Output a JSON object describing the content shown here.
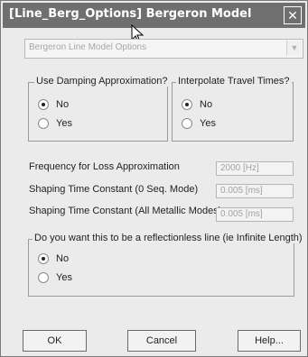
{
  "window": {
    "title": "[Line_Berg_Options] Bergeron Model"
  },
  "model_select": {
    "value": "Bergeron Line Model Options"
  },
  "damping": {
    "legend": "Use Damping Approximation?",
    "options": [
      {
        "label": "No",
        "checked": true
      },
      {
        "label": "Yes",
        "checked": false
      }
    ]
  },
  "travel": {
    "legend": "Interpolate Travel Times?",
    "options": [
      {
        "label": "No",
        "checked": true
      },
      {
        "label": "Yes",
        "checked": false
      }
    ]
  },
  "params": [
    {
      "label": "Frequency for Loss Approximation",
      "value": "2000 [Hz]"
    },
    {
      "label": "Shaping Time Constant (0 Seq. Mode)",
      "value": "0.005 [ms]"
    },
    {
      "label": "Shaping Time Constant (All Metallic Modes)",
      "value": "0.005 [ms]"
    }
  ],
  "reflectionless": {
    "legend": "Do you want this to be a reflectionless line (ie Infinite Length)",
    "options": [
      {
        "label": "No",
        "checked": true
      },
      {
        "label": "Yes",
        "checked": false
      }
    ]
  },
  "buttons": {
    "ok": "OK",
    "cancel": "Cancel",
    "help": "Help..."
  }
}
